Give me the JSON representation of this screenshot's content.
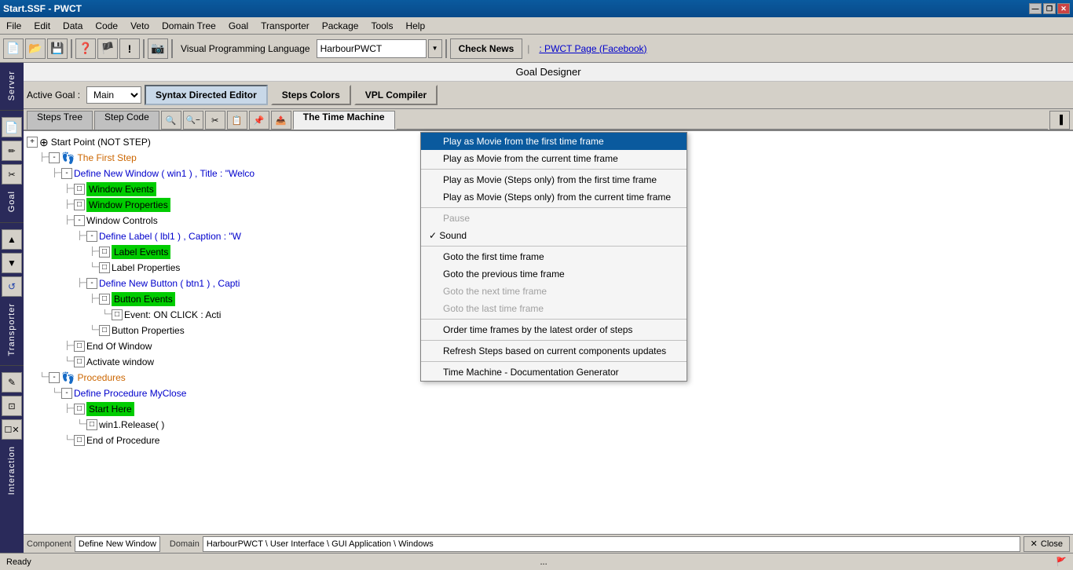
{
  "titlebar": {
    "title": "Start.SSF - PWCT",
    "minimize": "—",
    "restore": "❐",
    "close": "✕"
  },
  "menubar": {
    "items": [
      "File",
      "Edit",
      "Data",
      "Code",
      "Veto",
      "Domain Tree",
      "Goal",
      "Transporter",
      "Package",
      "Tools",
      "Help"
    ]
  },
  "toolbar": {
    "vpl_label": "Visual Programming Language",
    "vpl_value": "HarbourPWCT",
    "check_news": "Check News",
    "pwct_link": ": PWCT Page (Facebook)"
  },
  "goal_designer": {
    "title": "Goal Designer",
    "active_goal_label": "Active Goal :",
    "active_goal_value": "Main",
    "btn_syntax": "Syntax Directed Editor",
    "btn_steps_colors": "Steps Colors",
    "btn_vpl_compiler": "VPL Compiler"
  },
  "tabs": {
    "steps_tree": "Steps Tree",
    "step_code": "Step Code",
    "time_machine": "The Time Machine"
  },
  "tree": {
    "nodes": [
      {
        "level": 0,
        "type": "root",
        "icon": "⊕",
        "text": "Start Point (NOT STEP)",
        "color": "default",
        "expander": null
      },
      {
        "level": 1,
        "type": "branch",
        "icon": "⊖",
        "text": "The First Step",
        "color": "orange",
        "expander": "-"
      },
      {
        "level": 2,
        "type": "branch",
        "icon": "⊖",
        "text": "Define New Window  ( win1 ) , Title : \"Welco",
        "color": "blue",
        "expander": "-"
      },
      {
        "level": 3,
        "type": "leaf",
        "icon": "□",
        "text": "Window Events",
        "color": "green_bg",
        "expander": null
      },
      {
        "level": 3,
        "type": "leaf",
        "icon": "□",
        "text": "Window Properties",
        "color": "green_bg",
        "expander": null
      },
      {
        "level": 3,
        "type": "branch",
        "icon": "⊖",
        "text": "Window Controls",
        "color": "default",
        "expander": "-"
      },
      {
        "level": 4,
        "type": "branch",
        "icon": "⊖",
        "text": "Define Label ( lbl1 ) , Caption : \"W",
        "color": "blue",
        "expander": "-"
      },
      {
        "level": 5,
        "type": "leaf",
        "icon": "□",
        "text": "Label Events",
        "color": "green_bg",
        "expander": null
      },
      {
        "level": 5,
        "type": "leaf",
        "icon": "□",
        "text": "Label Properties",
        "color": "default",
        "expander": null
      },
      {
        "level": 4,
        "type": "branch",
        "icon": "⊖",
        "text": "Define New Button ( btn1 ) , Capti",
        "color": "blue",
        "expander": "-"
      },
      {
        "level": 5,
        "type": "leaf",
        "icon": "□",
        "text": "Button Events",
        "color": "green_bg",
        "expander": null
      },
      {
        "level": 6,
        "type": "leaf",
        "icon": "□",
        "text": "Event: ON CLICK : Acti",
        "color": "default",
        "expander": null
      },
      {
        "level": 5,
        "type": "leaf",
        "icon": "□",
        "text": "Button Properties",
        "color": "default",
        "expander": null
      },
      {
        "level": 3,
        "type": "leaf",
        "icon": "□",
        "text": "End Of Window",
        "color": "default",
        "expander": null
      },
      {
        "level": 3,
        "type": "leaf",
        "icon": "□",
        "text": "Activate window",
        "color": "default",
        "expander": null
      },
      {
        "level": 1,
        "type": "branch",
        "icon": "⊖",
        "text": "Procedures",
        "color": "orange",
        "expander": "-"
      },
      {
        "level": 2,
        "type": "branch",
        "icon": "⊖",
        "text": "Define Procedure MyClose",
        "color": "blue",
        "expander": "-"
      },
      {
        "level": 3,
        "type": "leaf",
        "icon": "□",
        "text": "Start Here",
        "color": "green_bg",
        "expander": null
      },
      {
        "level": 4,
        "type": "leaf",
        "icon": "□",
        "text": "win1.Release( )",
        "color": "default",
        "expander": null
      },
      {
        "level": 3,
        "type": "leaf",
        "icon": "□",
        "text": "End of Procedure",
        "color": "default",
        "expander": null
      }
    ]
  },
  "dropdown_menu": {
    "items": [
      {
        "id": "play_first",
        "text": "Play as Movie from the first time frame",
        "highlighted": true,
        "disabled": false,
        "checked": false
      },
      {
        "id": "play_current",
        "text": "Play as Movie from the current time frame",
        "highlighted": false,
        "disabled": false,
        "checked": false
      },
      {
        "id": "sep1",
        "type": "separator"
      },
      {
        "id": "play_steps_first",
        "text": "Play as Movie (Steps only) from the first time frame",
        "highlighted": false,
        "disabled": false,
        "checked": false
      },
      {
        "id": "play_steps_current",
        "text": "Play as Movie (Steps only) from the current time frame",
        "highlighted": false,
        "disabled": false,
        "checked": false
      },
      {
        "id": "sep2",
        "type": "separator"
      },
      {
        "id": "pause",
        "text": "Pause",
        "highlighted": false,
        "disabled": true,
        "checked": false
      },
      {
        "id": "sound",
        "text": "Sound",
        "highlighted": false,
        "disabled": false,
        "checked": true
      },
      {
        "id": "sep3",
        "type": "separator"
      },
      {
        "id": "goto_first",
        "text": "Goto the first time frame",
        "highlighted": false,
        "disabled": false,
        "checked": false
      },
      {
        "id": "goto_prev",
        "text": "Goto the previous time frame",
        "highlighted": false,
        "disabled": false,
        "checked": false
      },
      {
        "id": "goto_next",
        "text": "Goto the next time frame",
        "highlighted": false,
        "disabled": true,
        "checked": false
      },
      {
        "id": "goto_last",
        "text": "Goto the last time frame",
        "highlighted": false,
        "disabled": true,
        "checked": false
      },
      {
        "id": "sep4",
        "type": "separator"
      },
      {
        "id": "order_frames",
        "text": "Order time frames by the latest order of steps",
        "highlighted": false,
        "disabled": false,
        "checked": false
      },
      {
        "id": "sep5",
        "type": "separator"
      },
      {
        "id": "refresh_steps",
        "text": "Refresh Steps based on current components updates",
        "highlighted": false,
        "disabled": false,
        "checked": false
      },
      {
        "id": "sep6",
        "type": "separator"
      },
      {
        "id": "doc_gen",
        "text": "Time Machine - Documentation Generator",
        "highlighted": false,
        "disabled": false,
        "checked": false
      }
    ]
  },
  "statusbar": {
    "component_label": "Component",
    "component_value": "Define New Window",
    "domain_label": "Domain",
    "domain_value": "HarbourPWCT \\ User Interface \\ GUI Application \\ Windows",
    "close_btn": "Close"
  },
  "bottombar": {
    "ready": "Ready",
    "dots": "...",
    "icon": "🚩"
  },
  "sidebar": {
    "server_label": "Server",
    "goal_label": "Goal",
    "transporter_label": "Transporter",
    "interaction_label": "Interaction"
  }
}
